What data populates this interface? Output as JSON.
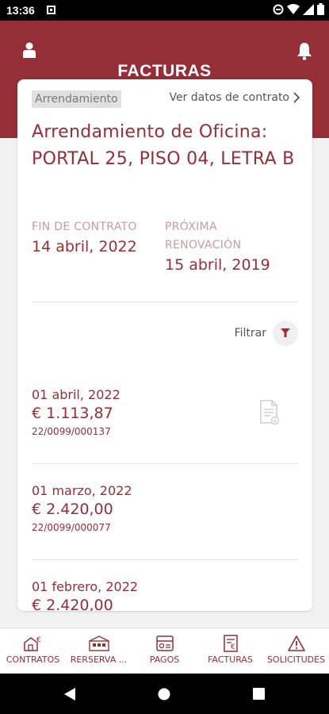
{
  "status_bar": {
    "time": "13:36"
  },
  "header": {
    "title": "FACTURAS"
  },
  "contract": {
    "chip": "Arrendamiento",
    "view_link": "Ver datos de contrato",
    "title": "Arrendamiento de Oficina: PORTAL 25, PISO 04, LETRA B",
    "end_label": "FIN DE CONTRATO",
    "end_value": "14 abril, 2022",
    "renewal_label_1": "PRÓXIMA",
    "renewal_label_2": "RENOVACIÓN",
    "renewal_value": "15 abril, 2019"
  },
  "filter": {
    "label": "Filtrar"
  },
  "invoices": [
    {
      "date": "01 abril, 2022",
      "amount": "€ 1.113,87",
      "number": "22/0099/000137"
    },
    {
      "date": "01 marzo, 2022",
      "amount": "€ 2.420,00",
      "number": "22/0099/000077"
    },
    {
      "date": "01 febrero, 2022",
      "amount": "€ 2.420,00"
    }
  ],
  "bottom_nav": {
    "items": [
      {
        "label": "CONTRATOS",
        "icon": "contracts-icon"
      },
      {
        "label": "RERSERVA ...",
        "icon": "reservations-icon"
      },
      {
        "label": "PAGOS",
        "icon": "payments-icon"
      },
      {
        "label": "FACTURAS",
        "icon": "invoices-icon"
      },
      {
        "label": "SOLICITUDES",
        "icon": "warning-icon"
      }
    ]
  },
  "colors": {
    "brand": "#962e38",
    "muted_brand": "#c99ba0",
    "background": "#f2f2f2"
  }
}
